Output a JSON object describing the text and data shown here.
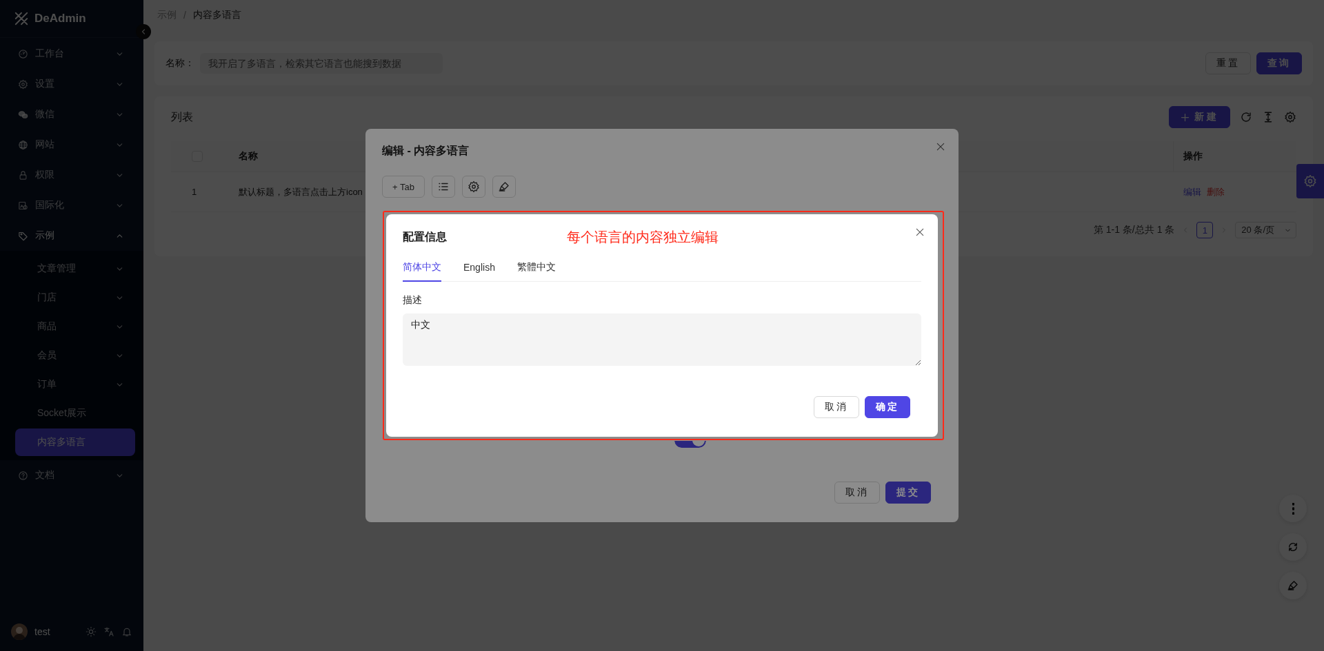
{
  "sidebar": {
    "logo": "DeAdmin",
    "items": [
      {
        "label": "工作台",
        "expanded": false
      },
      {
        "label": "设置",
        "expanded": false
      },
      {
        "label": "微信",
        "expanded": false
      },
      {
        "label": "网站",
        "expanded": false
      },
      {
        "label": "权限",
        "expanded": false
      },
      {
        "label": "国际化",
        "expanded": false
      },
      {
        "label": "示例",
        "expanded": true,
        "children": [
          {
            "label": "文章管理",
            "kind": "submenu",
            "expanded": false,
            "selected": false
          },
          {
            "label": "门店",
            "kind": "submenu",
            "expanded": false,
            "selected": false
          },
          {
            "label": "商品",
            "kind": "submenu",
            "expanded": false,
            "selected": false
          },
          {
            "label": "会员",
            "kind": "submenu",
            "expanded": false,
            "selected": false
          },
          {
            "label": "订单",
            "kind": "submenu",
            "expanded": false,
            "selected": false
          },
          {
            "label": "Socket展示",
            "kind": "link",
            "selected": false
          },
          {
            "label": "内容多语言",
            "kind": "link",
            "selected": true
          }
        ]
      },
      {
        "label": "文档",
        "expanded": false
      }
    ],
    "user": {
      "name": "test"
    }
  },
  "breadcrumb": {
    "items": [
      "示例",
      "内容多语言"
    ],
    "separator": "/"
  },
  "search": {
    "label": "名称：",
    "placeholder": "我开启了多语言，检索其它语言也能搜到数据",
    "buttons": [
      {
        "label": "重置",
        "kind": "default"
      },
      {
        "label": "查询",
        "kind": "primary"
      }
    ]
  },
  "list": {
    "title": "列表",
    "new_button": "新建",
    "select_all": {
      "checked": false
    },
    "columns": [
      {
        "label": "名称"
      },
      {
        "label": "操作"
      }
    ],
    "rows": [
      {
        "index": "1",
        "name": "默认标题，多语言点击上方icon",
        "actions": [
          {
            "label": "编辑",
            "kind": "edit"
          },
          {
            "label": "删除",
            "kind": "delete"
          }
        ]
      }
    ],
    "pagination": {
      "summary": "第 1-1 条/总共 1 条",
      "pages": [
        {
          "label": "1",
          "selected": true
        }
      ],
      "page_size": "20 条/页"
    }
  },
  "edit_modal": {
    "title": "编辑 - 内容多语言",
    "add_tab_button": "+ Tab",
    "switch": {
      "on": true
    },
    "buttons": [
      {
        "label": "取消",
        "kind": "default"
      },
      {
        "label": "提交",
        "kind": "primary"
      }
    ]
  },
  "config_modal": {
    "title": "配置信息",
    "annotation": "每个语言的内容独立编辑",
    "tabs": [
      {
        "label": "简体中文",
        "selected": true
      },
      {
        "label": "English",
        "selected": false
      },
      {
        "label": "繁體中文",
        "selected": false
      }
    ],
    "field": {
      "label": "描述",
      "value": "中文"
    },
    "buttons": [
      {
        "label": "取消",
        "kind": "default"
      },
      {
        "label": "确定",
        "kind": "primary"
      }
    ]
  }
}
